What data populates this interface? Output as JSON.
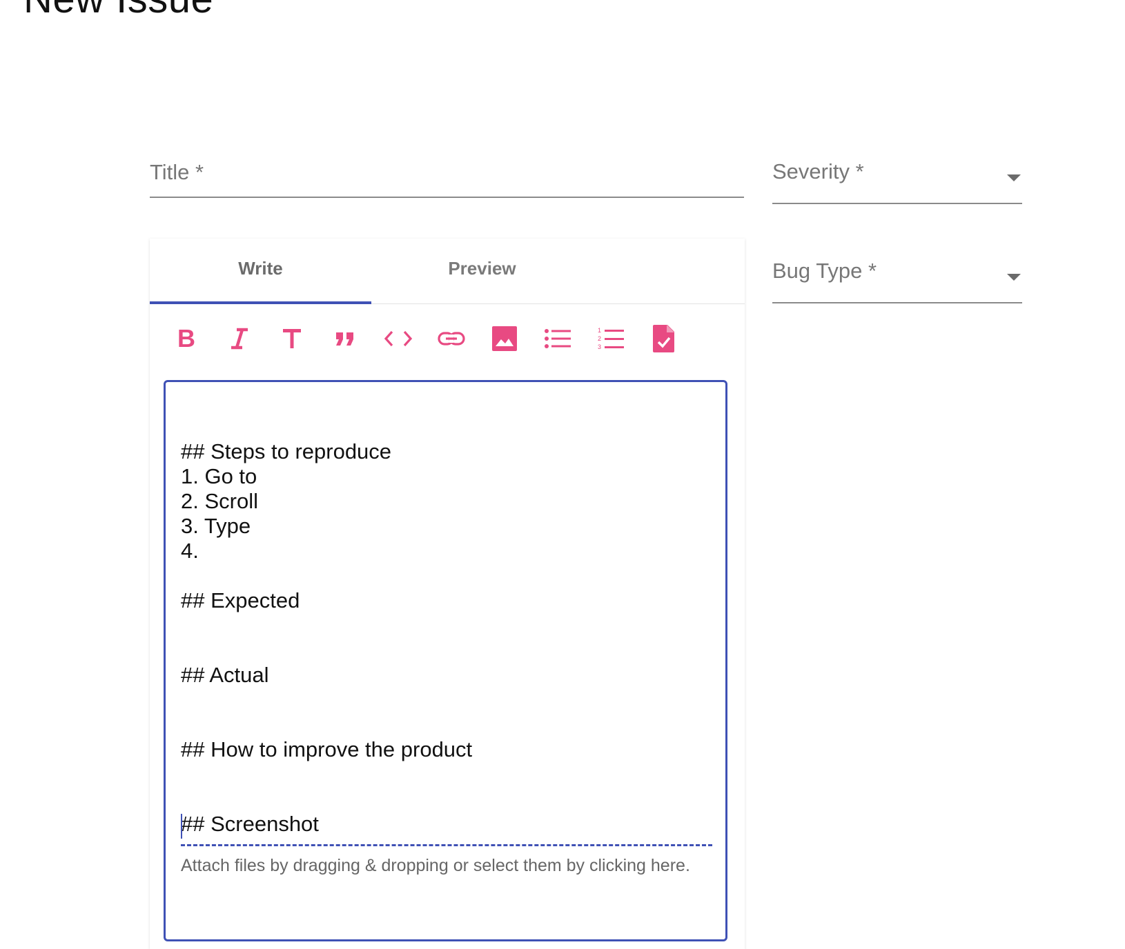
{
  "page": {
    "title": "New Issue"
  },
  "form": {
    "title_label": "Title *",
    "severity_label": "Severity *",
    "bug_type_label": "Bug Type *"
  },
  "editor": {
    "tabs": [
      {
        "label": "Write",
        "active": true
      },
      {
        "label": "Preview",
        "active": false
      }
    ],
    "toolbar": [
      {
        "name": "bold-icon"
      },
      {
        "name": "italic-icon"
      },
      {
        "name": "header-icon"
      },
      {
        "name": "quote-icon"
      },
      {
        "name": "code-icon"
      },
      {
        "name": "link-icon"
      },
      {
        "name": "image-icon"
      },
      {
        "name": "unordered-list-icon"
      },
      {
        "name": "ordered-list-icon"
      },
      {
        "name": "checked-list-icon"
      }
    ],
    "content": "\n## Steps to reproduce\n1. Go to\n2. Scroll\n3. Type\n4.\n\n## Expected\n\n\n## Actual\n\n\n## How to improve the product\n\n\n## Screenshot",
    "attach_text": "Attach files by dragging & dropping or select them by clicking here."
  },
  "colors": {
    "accent": "#3f51b5",
    "toolbar_icon": "#e84a82",
    "label": "#777777"
  }
}
